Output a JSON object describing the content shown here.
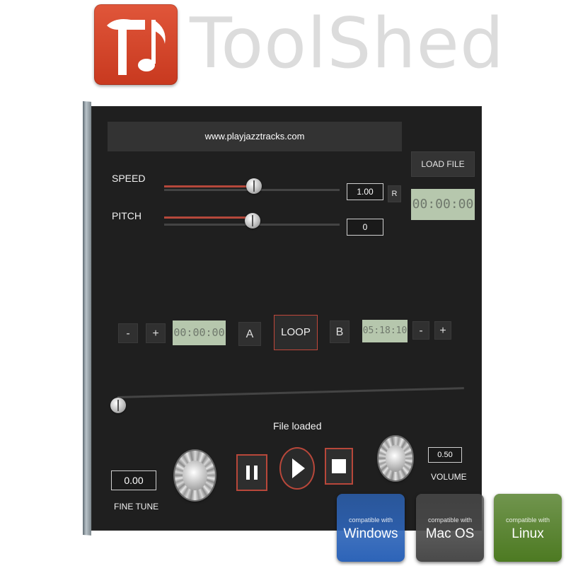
{
  "brand": {
    "name": "ToolShed"
  },
  "player": {
    "url": "www.playjazztracks.com",
    "load_file": "LOAD FILE",
    "time_display": "00:00:00",
    "speed": {
      "label": "SPEED",
      "value": "1.00",
      "reset": "R",
      "level": 0.55
    },
    "pitch": {
      "label": "PITCH",
      "value": "0",
      "level": 0.52
    },
    "loop": {
      "start_minus": "-",
      "start_plus": "+",
      "start_time": "00:00:00",
      "a": "A",
      "loop": "LOOP",
      "b": "B",
      "end_time": "05:18:10",
      "end_minus": "-",
      "end_plus": "+"
    },
    "position_level": 0.0,
    "status": "File loaded",
    "fine_tune": {
      "value": "0.00",
      "label": "FINE TUNE"
    },
    "volume": {
      "value": "0.50",
      "label": "VOLUME"
    }
  },
  "compat": [
    {
      "top": "compatible with",
      "name": "Windows",
      "color": "#2d64b8"
    },
    {
      "top": "compatible with",
      "name": "Mac OS",
      "color": "#4a4a4a"
    },
    {
      "top": "compatible with",
      "name": "Linux",
      "color": "#4d7a22"
    }
  ]
}
